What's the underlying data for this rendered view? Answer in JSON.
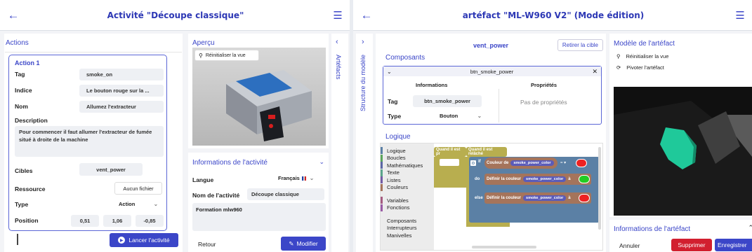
{
  "left": {
    "title": "Activité \"Découpe classique\"",
    "actions_title": "Actions",
    "action": {
      "header": "Action 1",
      "tag_label": "Tag",
      "tag_value": "smoke_on",
      "indice_label": "Indice",
      "indice_value": "Le bouton rouge sur la ...",
      "nom_label": "Nom",
      "nom_value": "Allumez l'extracteur",
      "description_label": "Description",
      "description_value": "Pour commencer il faut allumer l'extracteur de fumée situé à droite de la machine",
      "cibles_label": "Cibles",
      "cibles_value": "vent_power",
      "ressource_label": "Ressource",
      "ressource_value": "Aucun fichier",
      "type_label": "Type",
      "type_value": "Action",
      "position_label": "Position",
      "position_values": [
        "0,51",
        "1,06",
        "-0,85"
      ]
    },
    "launch_button": "Lancer l'activité",
    "apercu_title": "Aperçu",
    "reset_view": "Réinitialiser la vue",
    "artefacts_tab": "Artéfacts",
    "info_title": "Informations de l'activité",
    "langue_label": "Langue",
    "langue_value": "Français",
    "nom_activite_label": "Nom de l'activité",
    "nom_activite_value": "Découpe classique",
    "formation_value": "Formation mlw960",
    "retour": "Retour",
    "modifier": "Modifier"
  },
  "right": {
    "title": "artéfact \"ML-W960 V2\" (Mode édition)",
    "structure_tab": "Structure du modèle",
    "component_name": "vent_power",
    "retirer": "Retirer la cible",
    "composants_title": "Composants",
    "card_title": "btn_smoke_power",
    "informations": "Informations",
    "proprietes": "Propriétés",
    "tag_label": "Tag",
    "tag_value": "btn_smoke_power",
    "type_label": "Type",
    "type_value": "Bouton",
    "no_props": "Pas de propriétés",
    "logique_title": "Logique",
    "categories": [
      {
        "name": "Logique",
        "color": "#5b80a5"
      },
      {
        "name": "Boucles",
        "color": "#5ba55b"
      },
      {
        "name": "Mathématiques",
        "color": "#5b67a5"
      },
      {
        "name": "Texte",
        "color": "#5ba58c"
      },
      {
        "name": "Listes",
        "color": "#745ba5"
      },
      {
        "name": "Couleurs",
        "color": "#a5745b"
      },
      {
        "name": "Variables",
        "color": "#a55b80"
      },
      {
        "name": "Fonctions",
        "color": "#995ba5"
      },
      {
        "name": "Composants",
        "color": ""
      },
      {
        "name": "Interrupteurs",
        "color": ""
      },
      {
        "name": "Manivelles",
        "color": ""
      }
    ],
    "block_pressed": "Quand il est pr",
    "block_released": "Quand il est relâché",
    "if_kw": "if",
    "do_kw": "do",
    "else_kw": "else",
    "couleur_de": "Couleur de",
    "var_name": "smoke_power_color",
    "eq_op": "= ▾",
    "definir": "Définir la couleur",
    "a_kw": "à",
    "modele_title": "Modèle de l'artéfact",
    "reset_view": "Réinitialiser la vue",
    "pivot": "Pivoter l'artéfact",
    "info_title": "Informations de l'artéfact",
    "annuler": "Annuler",
    "supprimer": "Supprimer",
    "enregistrer": "Enregistrer"
  }
}
